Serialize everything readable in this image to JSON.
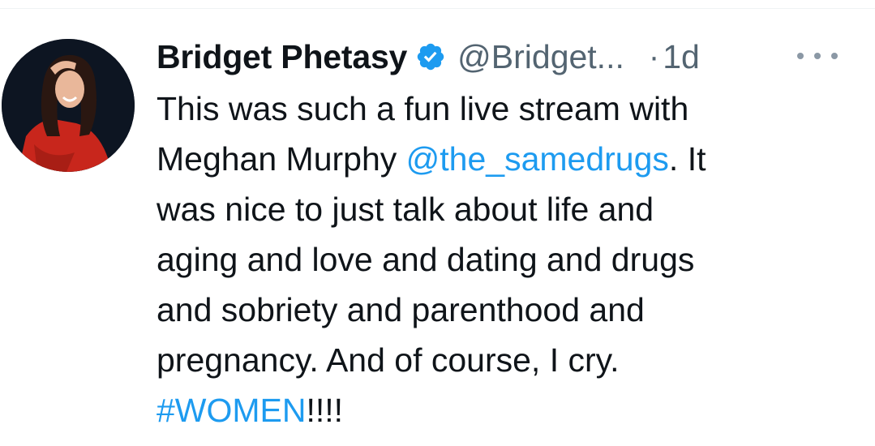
{
  "author": {
    "display_name": "Bridget Phetasy",
    "handle": "@Bridget...",
    "time_sep": "·",
    "time": "1d",
    "verified": true,
    "avatar_icon": "profile-photo"
  },
  "tweet": {
    "text_1": "This was such a fun live stream with\nMeghan Murphy ",
    "mention": "@the_samedrugs",
    "text_2": ". It\nwas nice to just talk about life and\naging and love and dating and drugs\nand sobriety and parenthood and\npregnancy. And of course, I cry.\n",
    "hashtag": "#WOMEN",
    "text_3": "!!!!"
  },
  "menu": {
    "more_icon": "more-horizontal-icon"
  },
  "colors": {
    "link": "#1d9bf0",
    "text": "#0f1419",
    "secondary": "#536471",
    "verified": "#1d9bf0"
  }
}
